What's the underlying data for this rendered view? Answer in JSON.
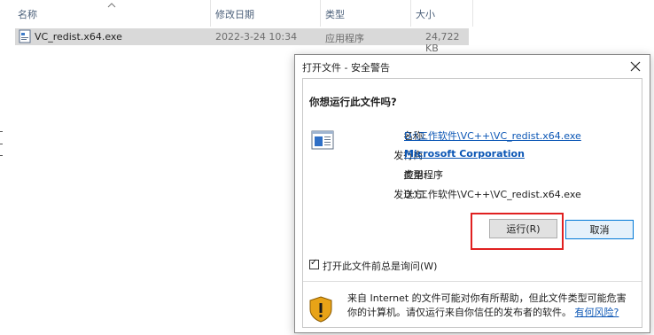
{
  "explorer": {
    "columns": {
      "name": "名称",
      "modified": "修改日期",
      "type": "类型",
      "size": "大小"
    },
    "file": {
      "name": "VC_redist.x64.exe",
      "modified": "2022-3-24 10:34",
      "type": "应用程序",
      "size": "24,722 KB"
    }
  },
  "dialog": {
    "title": "打开文件 - 安全警告",
    "question": "你想运行此文件吗?",
    "fields": {
      "name_label": "名称:",
      "name_value": "D:\\工作软件\\VC++\\VC_redist.x64.exe",
      "publisher_label": "发行商:",
      "publisher_value": "Microsoft Corporation",
      "type_label": "类型:",
      "type_value": "应用程序",
      "from_label": "发送方:",
      "from_value": "D:\\工作软件\\VC++\\VC_redist.x64.exe"
    },
    "buttons": {
      "run": "运行(R)",
      "cancel": "取消"
    },
    "checkbox": {
      "label": "打开此文件前总是询问(W)",
      "checked": true,
      "mark": "✓"
    },
    "warning": {
      "text": "来自 Internet 的文件可能对你有所帮助，但此文件类型可能危害你的计算机。请仅运行来自你信任的发布者的软件。",
      "link": "有何风险?"
    }
  },
  "colors": {
    "link": "#0b56b5",
    "highlight": "#e02020",
    "selected_row": "#d9d9d9"
  }
}
